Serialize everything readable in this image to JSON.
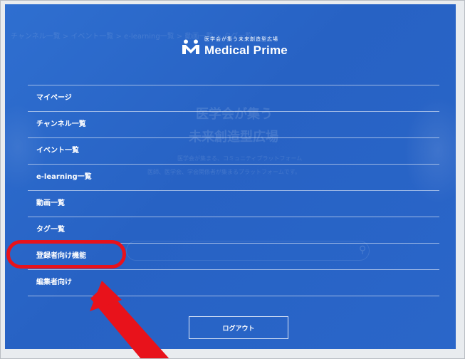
{
  "background": {
    "breadcrumb": "チャンネル一覧 > イベント一覧 > e-learning一覧 > 動画一覧 > タグ一覧",
    "heading_line1": "医学会が集う",
    "heading_line2": "未来創造型広場",
    "subtext_line1": "医学会が集まる、コミュニティプラットフォーム",
    "subtext_line2": "医師、医学会、学会関係者が集まるプラットフォームです。"
  },
  "logo": {
    "tagline": "医学会が集う未来創造型広場",
    "name": "Medical Prime",
    "icon": "medical-prime-logo-icon"
  },
  "menu": {
    "items": [
      {
        "label": "マイページ"
      },
      {
        "label": "チャンネル一覧"
      },
      {
        "label": "イベント一覧"
      },
      {
        "label": "e-learning一覧"
      },
      {
        "label": "動画一覧"
      },
      {
        "label": "タグ一覧"
      },
      {
        "label": "登録者向け機能"
      },
      {
        "label": "編集者向け"
      }
    ]
  },
  "logout": {
    "label": "ログアウト"
  },
  "annotation": {
    "highlight_color": "#e8121b",
    "highlighted_item": "登録者向け機能"
  },
  "colors": {
    "panel_blue": "#2a66c9",
    "text": "#ffffff"
  }
}
